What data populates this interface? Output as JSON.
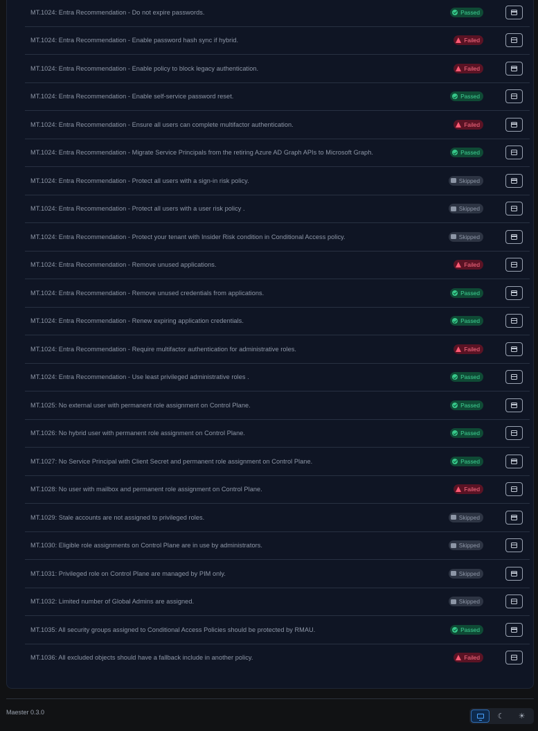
{
  "tests": [
    {
      "title": "MT.1024: Entra Recommendation - Do not expire passwords.",
      "status": "passed",
      "status_label": "Passed"
    },
    {
      "title": "MT.1024: Entra Recommendation - Enable password hash sync if hybrid.",
      "status": "failed",
      "status_label": "Failed"
    },
    {
      "title": "MT.1024: Entra Recommendation - Enable policy to block legacy authentication.",
      "status": "failed",
      "status_label": "Failed"
    },
    {
      "title": "MT.1024: Entra Recommendation - Enable self-service password reset.",
      "status": "passed",
      "status_label": "Passed"
    },
    {
      "title": "MT.1024: Entra Recommendation - Ensure all users can complete multifactor authentication.",
      "status": "failed",
      "status_label": "Failed"
    },
    {
      "title": "MT.1024: Entra Recommendation - Migrate Service Principals from the retiring Azure AD Graph APIs to Microsoft Graph.",
      "status": "passed",
      "status_label": "Passed"
    },
    {
      "title": "MT.1024: Entra Recommendation - Protect all users with a sign-in risk policy.",
      "status": "skipped",
      "status_label": "Skipped"
    },
    {
      "title": "MT.1024: Entra Recommendation - Protect all users with a user risk policy .",
      "status": "skipped",
      "status_label": "Skipped"
    },
    {
      "title": "MT.1024: Entra Recommendation - Protect your tenant with Insider Risk condition in Conditional Access policy.",
      "status": "skipped",
      "status_label": "Skipped"
    },
    {
      "title": "MT.1024: Entra Recommendation - Remove unused applications.",
      "status": "failed",
      "status_label": "Failed"
    },
    {
      "title": "MT.1024: Entra Recommendation - Remove unused credentials from applications.",
      "status": "passed",
      "status_label": "Passed"
    },
    {
      "title": "MT.1024: Entra Recommendation - Renew expiring application credentials.",
      "status": "passed",
      "status_label": "Passed"
    },
    {
      "title": "MT.1024: Entra Recommendation - Require multifactor authentication for administrative roles.",
      "status": "failed",
      "status_label": "Failed"
    },
    {
      "title": "MT.1024: Entra Recommendation - Use least privileged administrative roles .",
      "status": "passed",
      "status_label": "Passed"
    },
    {
      "title": "MT.1025: No external user with permanent role assignment on Control Plane.",
      "status": "passed",
      "status_label": "Passed"
    },
    {
      "title": "MT.1026: No hybrid user with permanent role assignment on Control Plane.",
      "status": "passed",
      "status_label": "Passed"
    },
    {
      "title": "MT.1027: No Service Principal with Client Secret and permanent role assignment on Control Plane.",
      "status": "passed",
      "status_label": "Passed"
    },
    {
      "title": "MT.1028: No user with mailbox and permanent role assignment on Control Plane.",
      "status": "failed",
      "status_label": "Failed"
    },
    {
      "title": "MT.1029: Stale accounts are not assigned to privileged roles.",
      "status": "skipped",
      "status_label": "Skipped"
    },
    {
      "title": "MT.1030: Eligible role assignments on Control Plane are in use by administrators.",
      "status": "skipped",
      "status_label": "Skipped"
    },
    {
      "title": "MT.1031: Privileged role on Control Plane are managed by PIM only.",
      "status": "skipped",
      "status_label": "Skipped"
    },
    {
      "title": "MT.1032: Limited number of Global Admins are assigned.",
      "status": "skipped",
      "status_label": "Skipped"
    },
    {
      "title": "MT.1035: All security groups assigned to Conditional Access Policies should be protected by RMAU.",
      "status": "passed",
      "status_label": "Passed"
    },
    {
      "title": "MT.1036: All excluded objects should have a fallback include in another policy.",
      "status": "failed",
      "status_label": "Failed"
    }
  ],
  "footer": {
    "version": "Maester 0.3.0",
    "theme_options": [
      {
        "name": "system",
        "icon": "monitor-icon",
        "active": true
      },
      {
        "name": "dark",
        "icon": "moon-icon",
        "active": false
      },
      {
        "name": "light",
        "icon": "sun-icon",
        "active": false
      }
    ]
  },
  "colors": {
    "passed": "#3fd395",
    "failed": "#ff6f86",
    "skipped": "#8d96a6",
    "accent": "#4aa3ff"
  }
}
